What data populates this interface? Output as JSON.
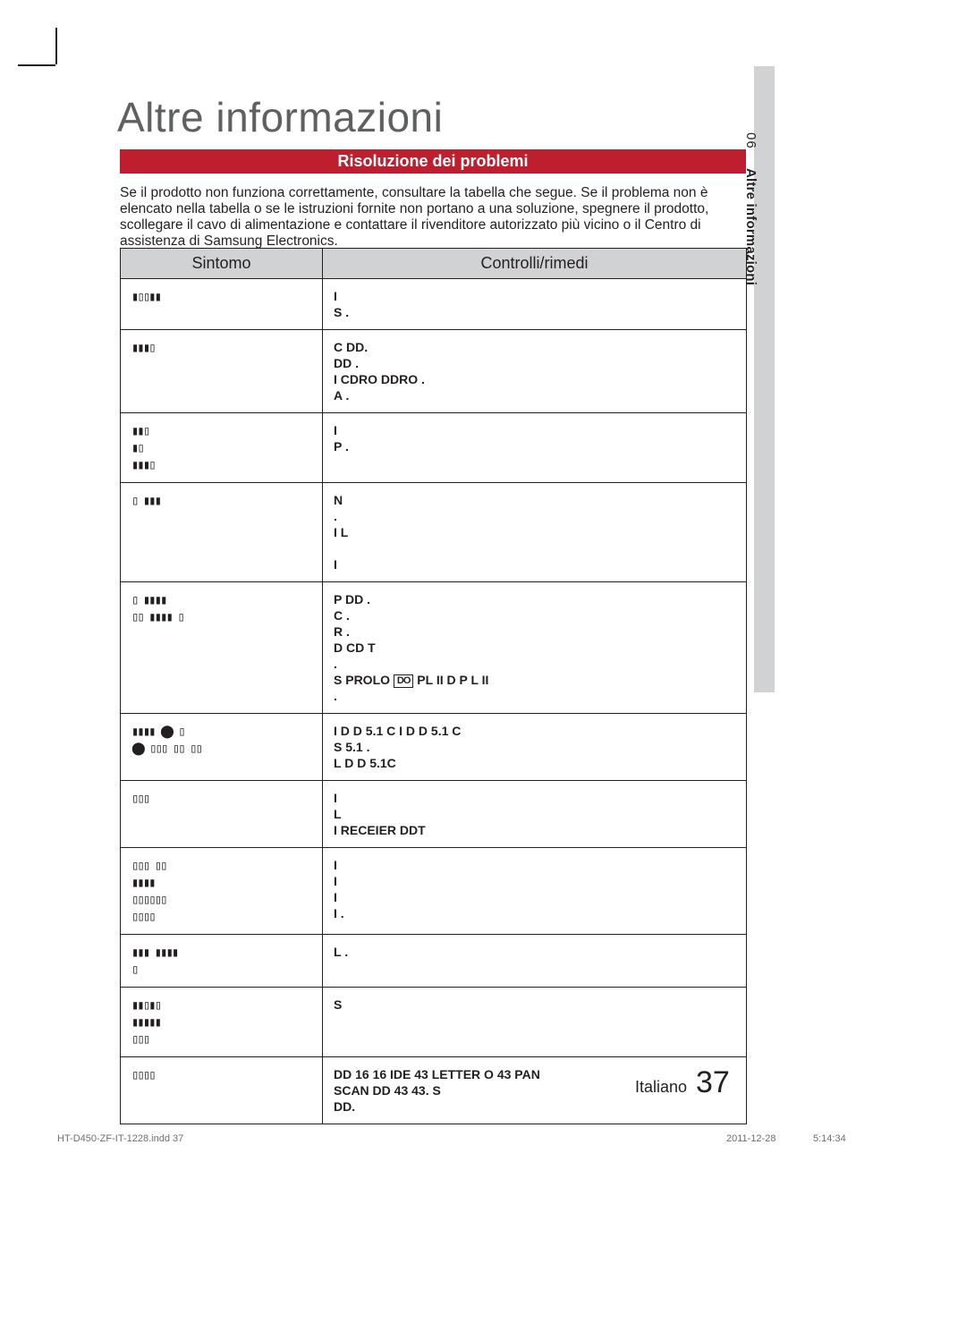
{
  "sidebar": {
    "chapter_num": "06",
    "chapter_title": "Altre informazioni"
  },
  "title": "Altre informazioni",
  "section_header": "Risoluzione dei problemi",
  "intro_text": "Se il prodotto non funziona correttamente, consultare la tabella che segue. Se il problema non è elencato nella tabella o se le istruzioni fornite non portano a una soluzione, spegnere il prodotto, scollegare il cavo di alimentazione e contattare il rivenditore autorizzato più vicino o il Centro di assistenza di Samsung Electronics.",
  "table": {
    "head_left": "Sintomo",
    "head_right": "Controlli/rimedi",
    "rows": [
      {
        "symptom": "▮▯▯▮▮",
        "remedy": "I\nS ."
      },
      {
        "symptom": "▮▮▮▯",
        "remedy": "C   DD.\n   DD   .\nI CDRO   DDRO    .\nA   ."
      },
      {
        "symptom": "▮▮▯\n▮▯\n▮▮▮▯",
        "remedy": "I\nP ."
      },
      {
        "symptom": "▯ ▮▮▮",
        "remedy": "N\n .\nI   L\n\nI"
      },
      {
        "symptom": "▯ ▮▮▮▮\n▯▯ ▮▮▮▮ ▯",
        "remedy": "P   DD    .\nC   .\nR .\nD   CD   T\n .\nS PROLO                        PL II D P L II\n .",
        "dolby": true
      },
      {
        "symptom": "▮▮▮▮ ⬤ ▯\n⬤ ▯▯▯ ▯▯ ▯▯",
        "remedy": "I    D D 5.1 C I   D D 5.1 C\nS         5.1 .\nL    D D 5.1C"
      },
      {
        "symptom": "▯▯▯",
        "remedy": "I\nL\nI  RECEIER DDT"
      },
      {
        "symptom": "▯▯▯ ▯▯\n▮▮▮▮\n▯▯▯▯▯▯\n   ▯▯▯▯",
        "remedy": "I\nI\nI\nI   ."
      },
      {
        "symptom": "▮▮▮ ▮▮▮▮\n▯",
        "remedy": "L      ."
      },
      {
        "symptom": "▮▮▯▮▯\n▮▮▮▮▮\n▯▯▯",
        "remedy": "S"
      },
      {
        "symptom": "▯▯▯▯",
        "remedy": "DD 16   16 IDE 43 LETTER O   43 PAN\nSCAN   DD 43      43. S\n   DD."
      }
    ]
  },
  "footer": {
    "lang": "Italiano",
    "page": "37",
    "file": "HT-D450-ZF-IT-1228.indd   37",
    "date": "2011-12-28",
    "time": "5:14:34"
  }
}
